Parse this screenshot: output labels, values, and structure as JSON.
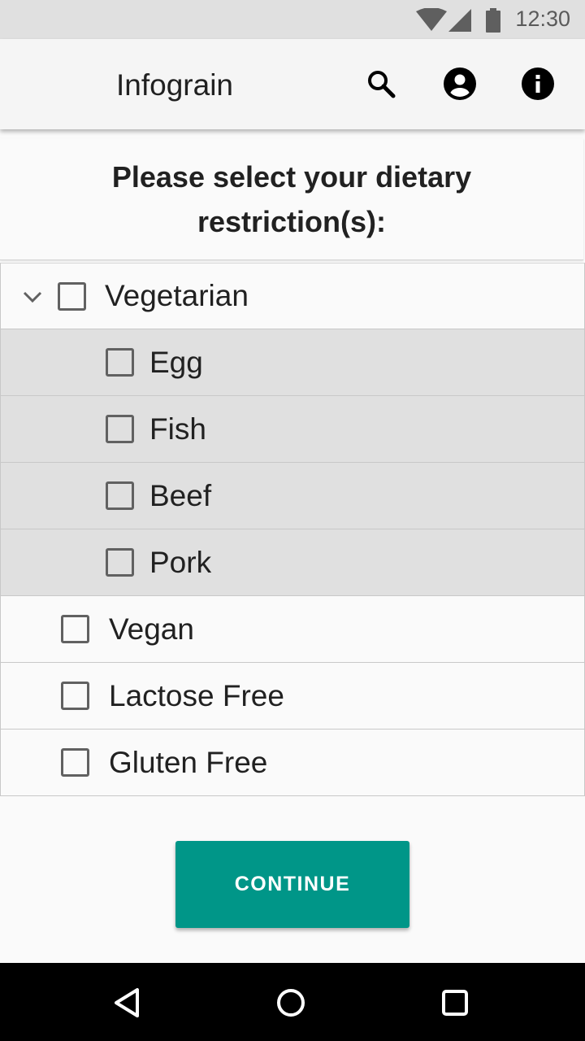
{
  "status_bar": {
    "time": "12:30",
    "icons": [
      "wifi-icon",
      "signal-icon",
      "battery-icon"
    ]
  },
  "app_bar": {
    "title": "Infograin",
    "actions": [
      "search-icon",
      "account-icon",
      "info-icon"
    ]
  },
  "prompt": {
    "text": "Please select your dietary restriction(s):"
  },
  "restrictions": {
    "vegetarian": {
      "label": "Vegetarian",
      "expanded": true,
      "checked": false
    },
    "sub_items": [
      {
        "label": "Egg",
        "checked": false
      },
      {
        "label": "Fish",
        "checked": false
      },
      {
        "label": "Beef",
        "checked": false
      },
      {
        "label": "Pork",
        "checked": false
      }
    ],
    "items": [
      {
        "label": "Vegan",
        "checked": false
      },
      {
        "label": "Lactose Free",
        "checked": false
      },
      {
        "label": "Gluten Free",
        "checked": false
      }
    ]
  },
  "actions": {
    "continue_label": "CONTINUE"
  },
  "colors": {
    "accent": "#009688",
    "status_bar": "#e0e0e0",
    "nested_row": "#e0e0e0",
    "nav_bar": "#000000"
  },
  "nav_bar": {
    "buttons": [
      "back-icon",
      "home-icon",
      "recents-icon"
    ]
  }
}
